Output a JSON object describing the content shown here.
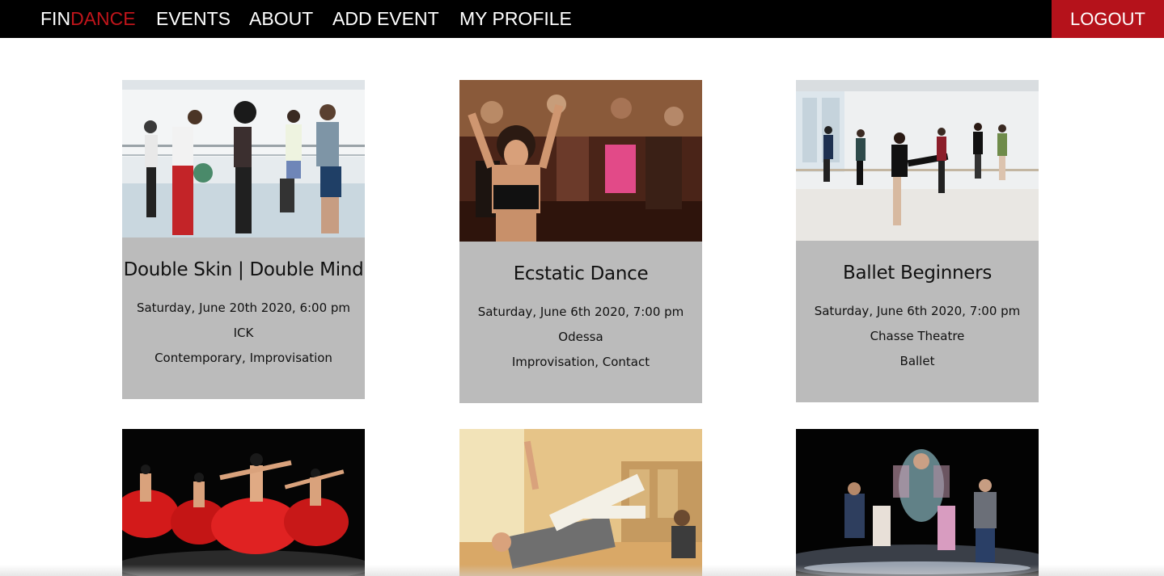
{
  "nav": {
    "brand_primary": "FIN",
    "brand_accent": "DANCE",
    "links": [
      "EVENTS",
      "ABOUT",
      "ADD EVENT",
      "MY PROFILE"
    ],
    "logout": "LOGOUT"
  },
  "events": [
    {
      "title": "Double Skin | Double Mind",
      "datetime": "Saturday, June 20th 2020, 6:00 pm",
      "venue": "ICK",
      "styles": "Contemporary, Improvisation"
    },
    {
      "title": "Ecstatic Dance",
      "datetime": "Saturday, June 6th 2020, 7:00 pm",
      "venue": "Odessa",
      "styles": "Improvisation, Contact"
    },
    {
      "title": "Ballet Beginners",
      "datetime": "Saturday, June 6th 2020, 7:00 pm",
      "venue": "Chasse Theatre",
      "styles": "Ballet"
    }
  ],
  "colors": {
    "nav_background": "#000000",
    "brand_accent": "#c0151b",
    "logout_background": "#b5121b",
    "card_info_background": "#bbbbbb"
  }
}
